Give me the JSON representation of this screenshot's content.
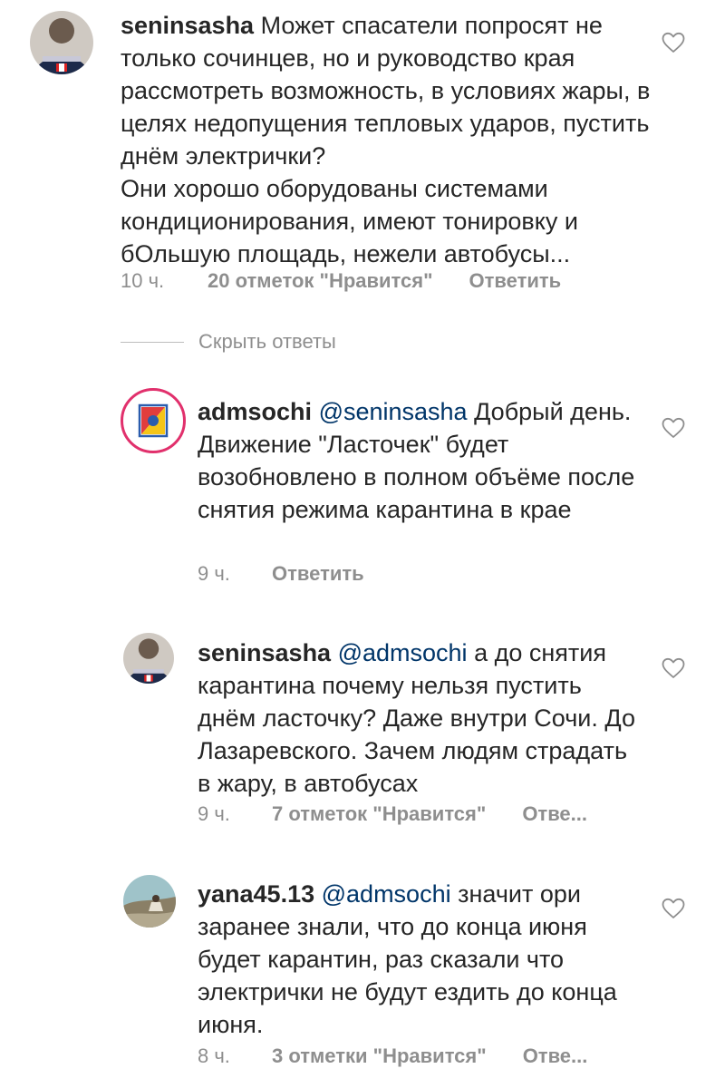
{
  "hide_replies_label": "Скрыть ответы",
  "comments": [
    {
      "username": "seninsasha",
      "mention": "",
      "text": "Может спасатели попросят не только сочинцев, но и руководство края рассмотреть возможность, в условиях жары, в целях недопущения тепловых ударов, пустить днём электрички?",
      "text2": "Они хорошо оборудованы системами кондиционирования, имеют тонировку и бОльшую площадь, нежели автобусы...",
      "time": "10 ч.",
      "likes": "20 отметок \"Нравится\"",
      "reply": "Ответить"
    },
    {
      "username": "admsochi",
      "mention": "@seninsasha",
      "text": "Добрый день. Движение \"Ласточек\" будет возобновлено в полном объёме после снятия режима карантина в крае",
      "time": "9 ч.",
      "likes": "",
      "reply": "Ответить"
    },
    {
      "username": "seninsasha",
      "mention": "@admsochi",
      "text": "а до снятия карантина почему нельзя пустить днём ласточку? Даже внутри Сочи. До Лазаревского.  Зачем людям страдать в жару, в автобусах",
      "time": "9 ч.",
      "likes": "7 отметок \"Нравится\"",
      "reply": "Отве..."
    },
    {
      "username": "yana45.13",
      "mention": "@admsochi",
      "text": "значит ори заранее знали, что до конца июня будет карантин, раз сказали что электрички не будут ездить до конца июня.",
      "time": "8 ч.",
      "likes": "3 отметки \"Нравится\"",
      "reply": "Отве..."
    }
  ],
  "colors": {
    "text": "#262626",
    "mention": "#003569",
    "meta": "#8e8e8e",
    "story_ring": "#e1306c"
  }
}
